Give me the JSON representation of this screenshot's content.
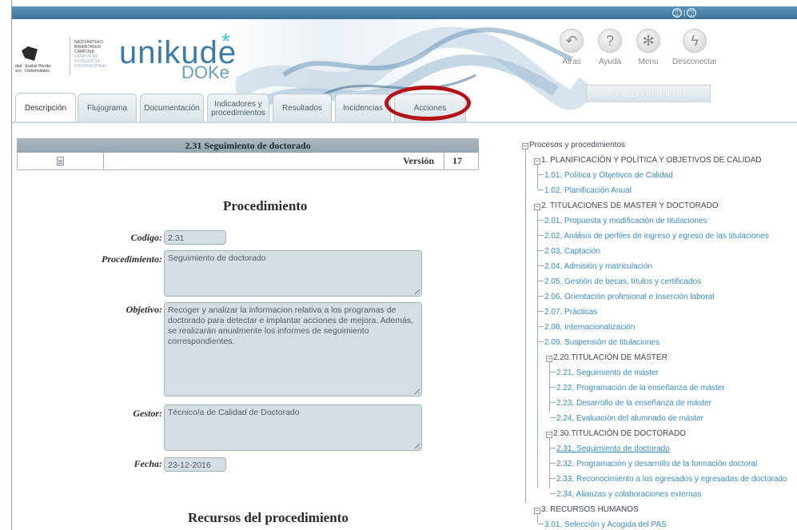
{
  "language": {
    "es": "es",
    "eu": "eu",
    "separator": "|"
  },
  "brand": {
    "name": "unikude",
    "subname": "DOKe",
    "university_lines": "dad   Euskal Herriko\nsco   Unibertsitatea",
    "campus_lines": [
      "NAZIOARTEKO",
      "BIKAINTASUN",
      "CAMPUSA"
    ],
    "campus_sub_lines": [
      "CAMPUS DE",
      "EXCELENCIA",
      "INTERNACIONAL"
    ]
  },
  "nav": {
    "back": "Atras",
    "help": "Ayuda",
    "menu": "Menu",
    "logout": "Desconectar",
    "view_procedures": "Ver procedimientos"
  },
  "tabs": {
    "descripcion": "Descripción",
    "flujograma": "Flujograma",
    "documentacion": "Documentación",
    "indicadores": "Indicadores y procedimientos",
    "resultados": "Resultados",
    "incidencias": "Incidencias",
    "acciones": "Acciones"
  },
  "procedure": {
    "title": "2.31 Seguimiento de doctorado",
    "version_label": "Versión",
    "version_value": "17",
    "section_title": "Procedimiento",
    "codigo_label": "Codigo:",
    "codigo_value": "2.31",
    "procedimiento_label": "Procedimiento:",
    "procedimiento_value": "Seguimiento de doctorado",
    "objetivo_label": "Objetivo:",
    "objetivo_value": "Recoger y analizar la informacion relativa a los programas de doctorado para detectar e implantar acciones de mejora. Además, se realizarán anualmente los informes de seguimiento correspondientes.",
    "gestor_label": "Gestor:",
    "gestor_value": "Técnico/a de Calidad de Doctorado",
    "fecha_label": "Fecha:",
    "fecha_value": "23-12-2016",
    "resources_title": "Recursos del procedimiento"
  },
  "tree": {
    "root": "Procesos y procedimientos",
    "g1": "1. PLANIFICACIÓN Y POLÍTICA Y OBJETIVOS DE CALIDAD",
    "g1_items": [
      "1.01, Política y Objetivos de Calidad",
      "1.02, Planificación Anual"
    ],
    "g2": "2. TITULACIONES DE MASTER Y DOCTORADO",
    "g2_items": [
      "2.01, Propuesta y modificación de titulaciones",
      "2.02, Análisis de perfiles de ingreso y egreso de las titulaciones",
      "2.03, Captación",
      "2.04, Admisión y matriculación",
      "2.05, Gestión de becas, títulos y certificados",
      "2.06, Orientación profesional e Inserción laboral",
      "2.07, Prácticas",
      "2.08, Internacionalización",
      "2.09, Suspensión de titulaciones"
    ],
    "g220": "2.20.TITULACIÓN DE MÁSTER",
    "g220_items": [
      "2.21, Seguimiento de máster",
      "2.22, Programación de la enseñanza de máster",
      "2.23, Desarrollo de la enseñanza de máster",
      "2.24, Evaluación del alumnado de máster"
    ],
    "g230": "2.30.TITULACIÓN DE DOCTORADO",
    "g230_items": [
      "2.31, Seguimiento de doctorado",
      "2.32, Programación y desarrollo de la formación doctoral",
      "2.33, Reconocimiento a los egresados y egresadas de doctorado",
      "2.34, Alianzas y colaboraciones externas"
    ],
    "g3": "3. RECURSOS HUMANOS",
    "g3_items": [
      "3.01, Selección y Acogida del PAS"
    ]
  },
  "colors": {
    "accent": "#3e7aa6",
    "link": "#3a8cc0",
    "highlight": "#b31217"
  }
}
